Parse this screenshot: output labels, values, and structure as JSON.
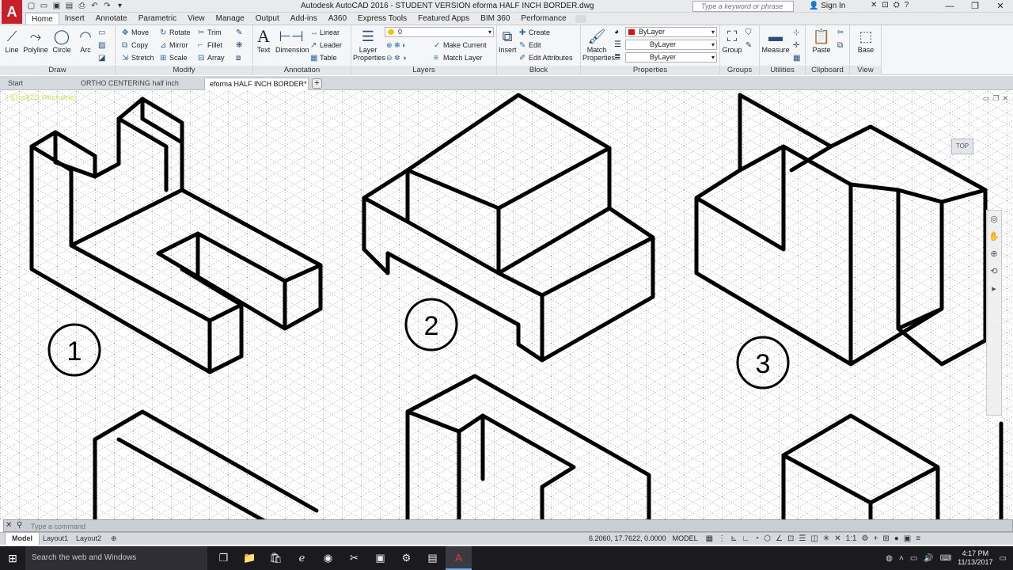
{
  "app": {
    "logo": "A",
    "title": "Autodesk AutoCAD 2016 - STUDENT VERSION    eforma HALF INCH BORDER.dwg",
    "search_placeholder": "Type a keyword or phrase",
    "sign_in": "Sign In"
  },
  "qat_icons": [
    "new-icon",
    "open-icon",
    "save-icon",
    "save-as-icon",
    "print-icon",
    "undo-icon",
    "redo-icon",
    "workspace-icon"
  ],
  "ribbon_tabs": [
    "Home",
    "Insert",
    "Annotate",
    "Parametric",
    "View",
    "Manage",
    "Output",
    "Add-ins",
    "A360",
    "Express Tools",
    "Featured Apps",
    "BIM 360",
    "Performance"
  ],
  "panels": {
    "draw": {
      "title": "Draw",
      "tools": [
        "Line",
        "Polyline",
        "Circle",
        "Arc"
      ]
    },
    "modify": {
      "title": "Modify",
      "tools": [
        "Move",
        "Rotate",
        "Trim",
        "Copy",
        "Mirror",
        "Fillet",
        "Stretch",
        "Scale",
        "Array"
      ]
    },
    "annotation": {
      "title": "Annotation",
      "text": "Text",
      "dimension": "Dimension",
      "linear": "Linear",
      "leader": "Leader",
      "table": "Table"
    },
    "layers": {
      "title": "Layers",
      "layer_properties": "Layer Properties",
      "current_layer": "0",
      "make_current": "Make Current",
      "match_layer": "Match Layer"
    },
    "block": {
      "title": "Block",
      "insert": "Insert",
      "create": "Create",
      "edit": "Edit",
      "edit_attributes": "Edit Attributes"
    },
    "properties": {
      "title": "Properties",
      "match_properties": "Match Properties",
      "color": "ByLayer",
      "linetype": "ByLayer",
      "lineweight": "ByLayer"
    },
    "groups": {
      "title": "Groups",
      "group": "Group"
    },
    "utilities": {
      "title": "Utilities",
      "measure": "Measure"
    },
    "clipboard": {
      "title": "Clipboard",
      "paste": "Paste"
    },
    "view": {
      "title": "View",
      "base": "Base"
    }
  },
  "doc_tabs": [
    "Start",
    "ORTHO CENTERING half inch boarder*",
    "eforma HALF INCH BORDER*"
  ],
  "canvas": {
    "viewport_label": "[-][Top][2D Wireframe]",
    "viewcube_label": "TOP",
    "figure_labels": [
      "1",
      "2",
      "3"
    ]
  },
  "command_line": {
    "placeholder": "Type a command"
  },
  "layout_tabs": [
    "Model",
    "Layout1",
    "Layout2"
  ],
  "status": {
    "coords": "6.2060, 17.7622, 0.0000",
    "mode": "MODEL",
    "scale": "1:1"
  },
  "taskbar": {
    "search": "Search the web and Windows",
    "time": "4:17 PM",
    "date": "11/13/2017"
  },
  "colors": {
    "accent": "#c8202a",
    "ribbon_bg": "#f5f6f7",
    "drawing_stroke": "#000000",
    "grid_dot": "#555555"
  }
}
